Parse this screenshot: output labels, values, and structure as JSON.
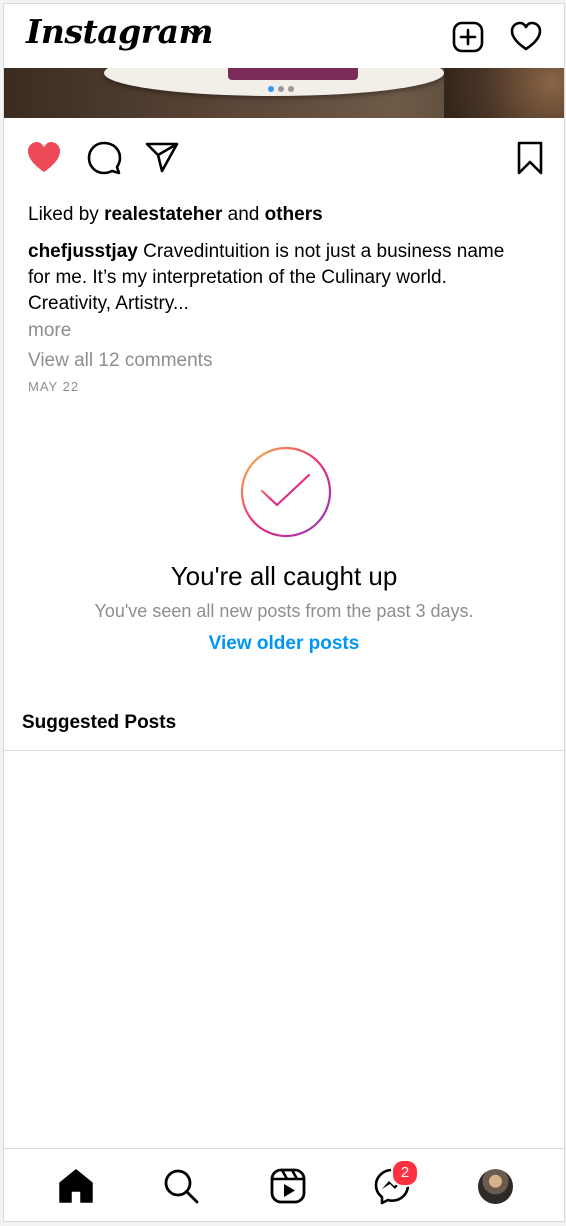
{
  "app": {
    "logo": "Instagram"
  },
  "post": {
    "liked_prefix": "Liked by",
    "liked_user": "realestateher",
    "liked_and": "and",
    "liked_others": "others",
    "caption_user": "chefjusstjay",
    "caption_text": " Cravedintuition is not just a business name for me. It’s my interpretation of the Culinary world. Creativity, Artistry...",
    "more_label": "more",
    "view_all_comments": "View all 12 comments",
    "date": "MAY 22",
    "liked": true,
    "carousel": {
      "count": 3,
      "active": 1
    }
  },
  "caught_up": {
    "title": "You're all caught up",
    "subtitle": "You've seen all new posts from the past 3 days.",
    "older_link": "View older posts"
  },
  "suggested": {
    "title": "Suggested Posts"
  },
  "nav": {
    "messages_badge": "2"
  },
  "colors": {
    "like": "#ed4956",
    "link": "#0095f6",
    "badge": "#ff3040"
  }
}
